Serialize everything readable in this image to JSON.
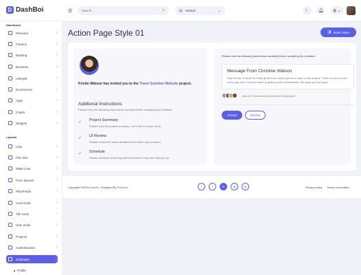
{
  "header": {
    "app_name": "DashBoi",
    "search_placeholder": "Search",
    "layout_value": "Vertical"
  },
  "sidebar": {
    "section_dashboard": "Dashboard",
    "dashboard_items": [
      {
        "label": "Personal"
      },
      {
        "label": "Finance"
      },
      {
        "label": "Banking"
      },
      {
        "label": "Business"
      },
      {
        "label": "Lifestyle"
      },
      {
        "label": "Ecommerce"
      },
      {
        "label": "Apps"
      },
      {
        "label": "Charts"
      },
      {
        "label": "Widgets"
      }
    ],
    "section_layouts": "Layouts",
    "layout_items": [
      {
        "label": "Lists"
      },
      {
        "label": "Flex lists"
      },
      {
        "label": "Table Lists"
      },
      {
        "label": "Form layouts"
      },
      {
        "label": "Placeholds"
      },
      {
        "label": "Card Grids"
      },
      {
        "label": "Tile Grids"
      },
      {
        "label": "User Grids"
      },
      {
        "label": "Projects"
      },
      {
        "label": "Authentication"
      },
      {
        "label": "Subpages"
      }
    ],
    "sub_item": "Profile"
  },
  "main": {
    "page_title": "Action Page Style 01",
    "invite_button": "Invite Users",
    "invite_prefix": "Kristin Watson has invited you to the ",
    "invite_link": "Travel Solution Website",
    "invite_suffix": " project.",
    "additional_title": "Additional Instructions",
    "additional_desc": "Please read the following instructions carefully before accepting the invitation.",
    "instructions": [
      {
        "title": "Project Summary",
        "desc": "Please read the project summary. You'll find it in your inbox."
      },
      {
        "title": "UI Review",
        "desc": "Please review the latest wireframes the team has provided."
      },
      {
        "title": "Schedule",
        "desc": "Please schedule a meeting with the team so they can help you up."
      }
    ],
    "right_note": "Please read the following instructions carefully before accepting the invitation.",
    "message_title": "Message From Christine Watson",
    "message_body": "Hey Henrik, it would be really great if you could give us a hand in this project. There is a lot of work every day and I think the team is getting a bit overwhelmed. We want you on board.",
    "members_text": "And 12+ others are members of this project",
    "accept_label": "Accept",
    "decline_label": "Decline"
  },
  "footer": {
    "copyright_prefix": "Copyright ©2023 ",
    "copyright_brand": "DashBo",
    "copyright_mid": ". Designed By ",
    "copyright_author": "Pixelbuis",
    "social_icons": [
      "f",
      "t",
      "in",
      "ig",
      "yt"
    ],
    "privacy": "Privacy policy",
    "terms": "Terms of condition"
  },
  "colors": {
    "accent": "#5b5fe6",
    "background": "#f1f2f8"
  }
}
